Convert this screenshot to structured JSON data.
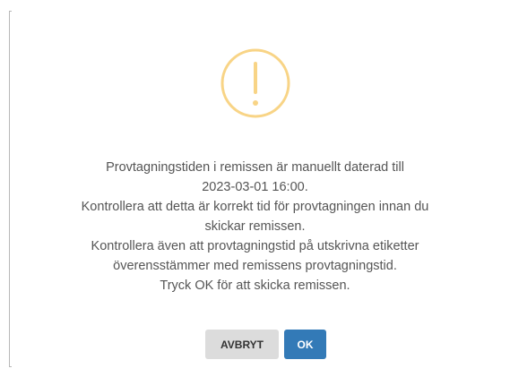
{
  "dialog": {
    "icon": "warning-exclamation-circle-icon",
    "icon_color": "#f8d486",
    "message_lines": [
      "Provtagningstiden i remissen är manuellt daterad till",
      "2023-03-01 16:00.",
      "Kontrollera att detta är korrekt tid för provtagningen innan du",
      "skickar remissen.",
      "Kontrollera även att provtagningstid på utskrivna etiketter",
      "överensstämmer med remissens provtagningstid.",
      "Tryck OK för att skicka remissen."
    ],
    "cancel_label": "AVBRYT",
    "ok_label": "OK",
    "cancel_color": "#dcdcdc",
    "ok_color": "#337ab7"
  }
}
